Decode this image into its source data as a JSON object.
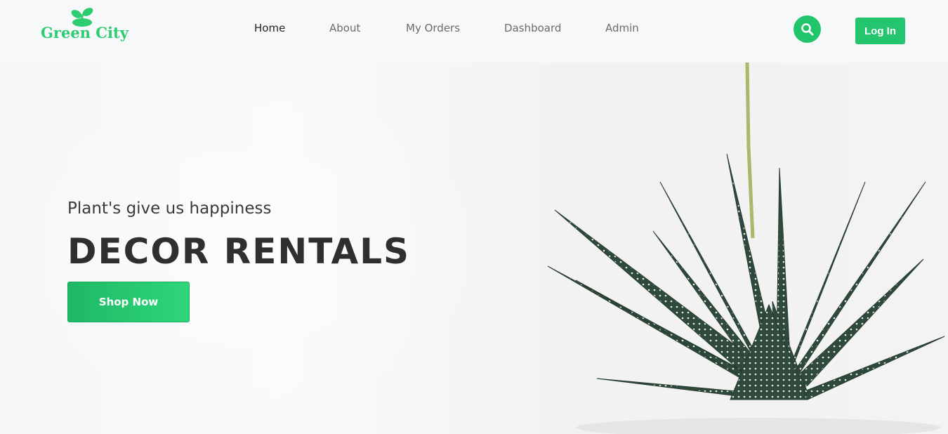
{
  "brand": {
    "name": "Green City",
    "accent_color": "#22c46b"
  },
  "nav": {
    "items": [
      {
        "label": "Home",
        "active": true
      },
      {
        "label": "About",
        "active": false
      },
      {
        "label": "My Orders",
        "active": false
      },
      {
        "label": "Dashboard",
        "active": false
      },
      {
        "label": "Admin",
        "active": false
      }
    ],
    "search_icon": "search-icon",
    "login_label": "Log In"
  },
  "hero": {
    "tagline": "Plant's give us happiness",
    "headline": "DECOR RENTALS",
    "cta_label": "Shop Now",
    "image": "aloe-plant-image"
  }
}
